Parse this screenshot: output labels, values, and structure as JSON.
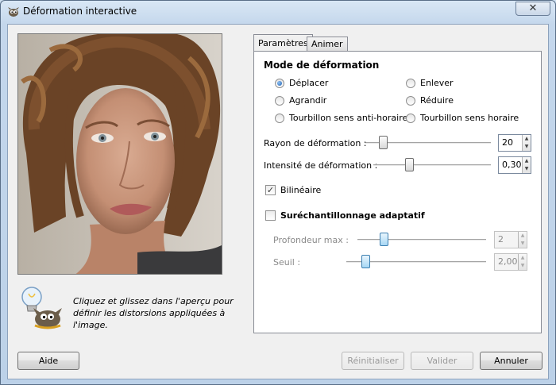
{
  "window": {
    "title": "Déformation interactive",
    "close_label": "✕"
  },
  "preview": {
    "hint": "Cliquez et glissez dans l'aperçu pour définir les distorsions appliquées à l'image."
  },
  "tabs": [
    {
      "label": "Paramètres",
      "active": true
    },
    {
      "label": "Animer",
      "active": false
    }
  ],
  "mode": {
    "title": "Mode de déformation",
    "options": [
      {
        "label": "Déplacer",
        "selected": true
      },
      {
        "label": "Enlever",
        "selected": false
      },
      {
        "label": "Agrandir",
        "selected": false
      },
      {
        "label": "Réduire",
        "selected": false
      },
      {
        "label": "Tourbillon sens anti-horaire",
        "selected": false
      },
      {
        "label": "Tourbillon sens horaire",
        "selected": false
      }
    ]
  },
  "radius": {
    "label": "Rayon de déformation :",
    "value": "20"
  },
  "intensity": {
    "label": "Intensité de déformation :",
    "value": "0,30"
  },
  "bilinear": {
    "label": "Bilinéaire",
    "checked": true
  },
  "supersampling": {
    "label": "Suréchantillonnage adaptatif",
    "checked": false,
    "depth": {
      "label": "Profondeur max :",
      "value": "2"
    },
    "threshold": {
      "label": "Seuil :",
      "value": "2,00"
    }
  },
  "buttons": {
    "help": "Aide",
    "reset": "Réinitialiser",
    "ok": "Valider",
    "cancel": "Annuler"
  },
  "icons": {
    "app": "gimp-icon",
    "hint": "lightbulb-gimp-icon"
  }
}
